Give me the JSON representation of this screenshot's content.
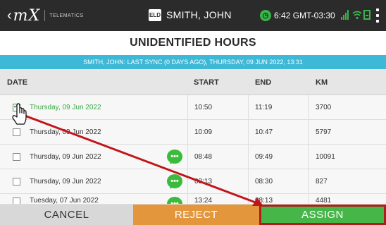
{
  "app": {
    "logo_text": "mX",
    "logo_subtitle": "TELEMATICS",
    "eld_badge": "ELD",
    "driver_name": "SMITH, JOHN",
    "time": "6:42 GMT-03:30"
  },
  "page": {
    "title": "UNIDENTIFIED HOURS",
    "sync_status": "SMITH, JOHN: LAST SYNC (0 DAYS AGO), THURSDAY, 09 JUN 2022, 13:31"
  },
  "table": {
    "headers": {
      "date": "DATE",
      "start": "START",
      "end": "END",
      "km": "KM"
    },
    "rows": [
      {
        "date": "Thursday, 09 Jun 2022",
        "start": "10:50",
        "end": "11:19",
        "km": "3700",
        "checked": true,
        "comment": false
      },
      {
        "date": "Thursday, 09 Jun 2022",
        "start": "10:09",
        "end": "10:47",
        "km": "5797",
        "checked": false,
        "comment": false
      },
      {
        "date": "Thursday, 09 Jun 2022",
        "start": "08:48",
        "end": "09:49",
        "km": "10091",
        "checked": false,
        "comment": true
      },
      {
        "date": "Thursday, 09 Jun 2022",
        "start": "08:13",
        "end": "08:30",
        "km": "827",
        "checked": false,
        "comment": true
      },
      {
        "date": "Tuesday, 07 Jun 2022",
        "start": "13:24",
        "end": "08:13",
        "km": "4481",
        "checked": false,
        "comment": true
      }
    ]
  },
  "buttons": {
    "cancel": "CANCEL",
    "reject": "REJECT",
    "assign": "ASSIGN"
  },
  "icons": {
    "back": "chevron-left-icon",
    "clock": "clock-icon",
    "signal": "signal-icon",
    "wifi": "wifi-icon",
    "battery": "battery-icon",
    "menu": "kebab-menu-icon",
    "comment": "chat-bubble-icon",
    "cursor": "hand-pointer-icon"
  },
  "colors": {
    "topbar": "#2b2b2b",
    "sync_banner": "#3db8d6",
    "cancel": "#d8d8d8",
    "reject": "#e3963c",
    "assign": "#46b649",
    "assign_highlight": "#b4191b",
    "annotation_arrow": "#c0161b"
  }
}
